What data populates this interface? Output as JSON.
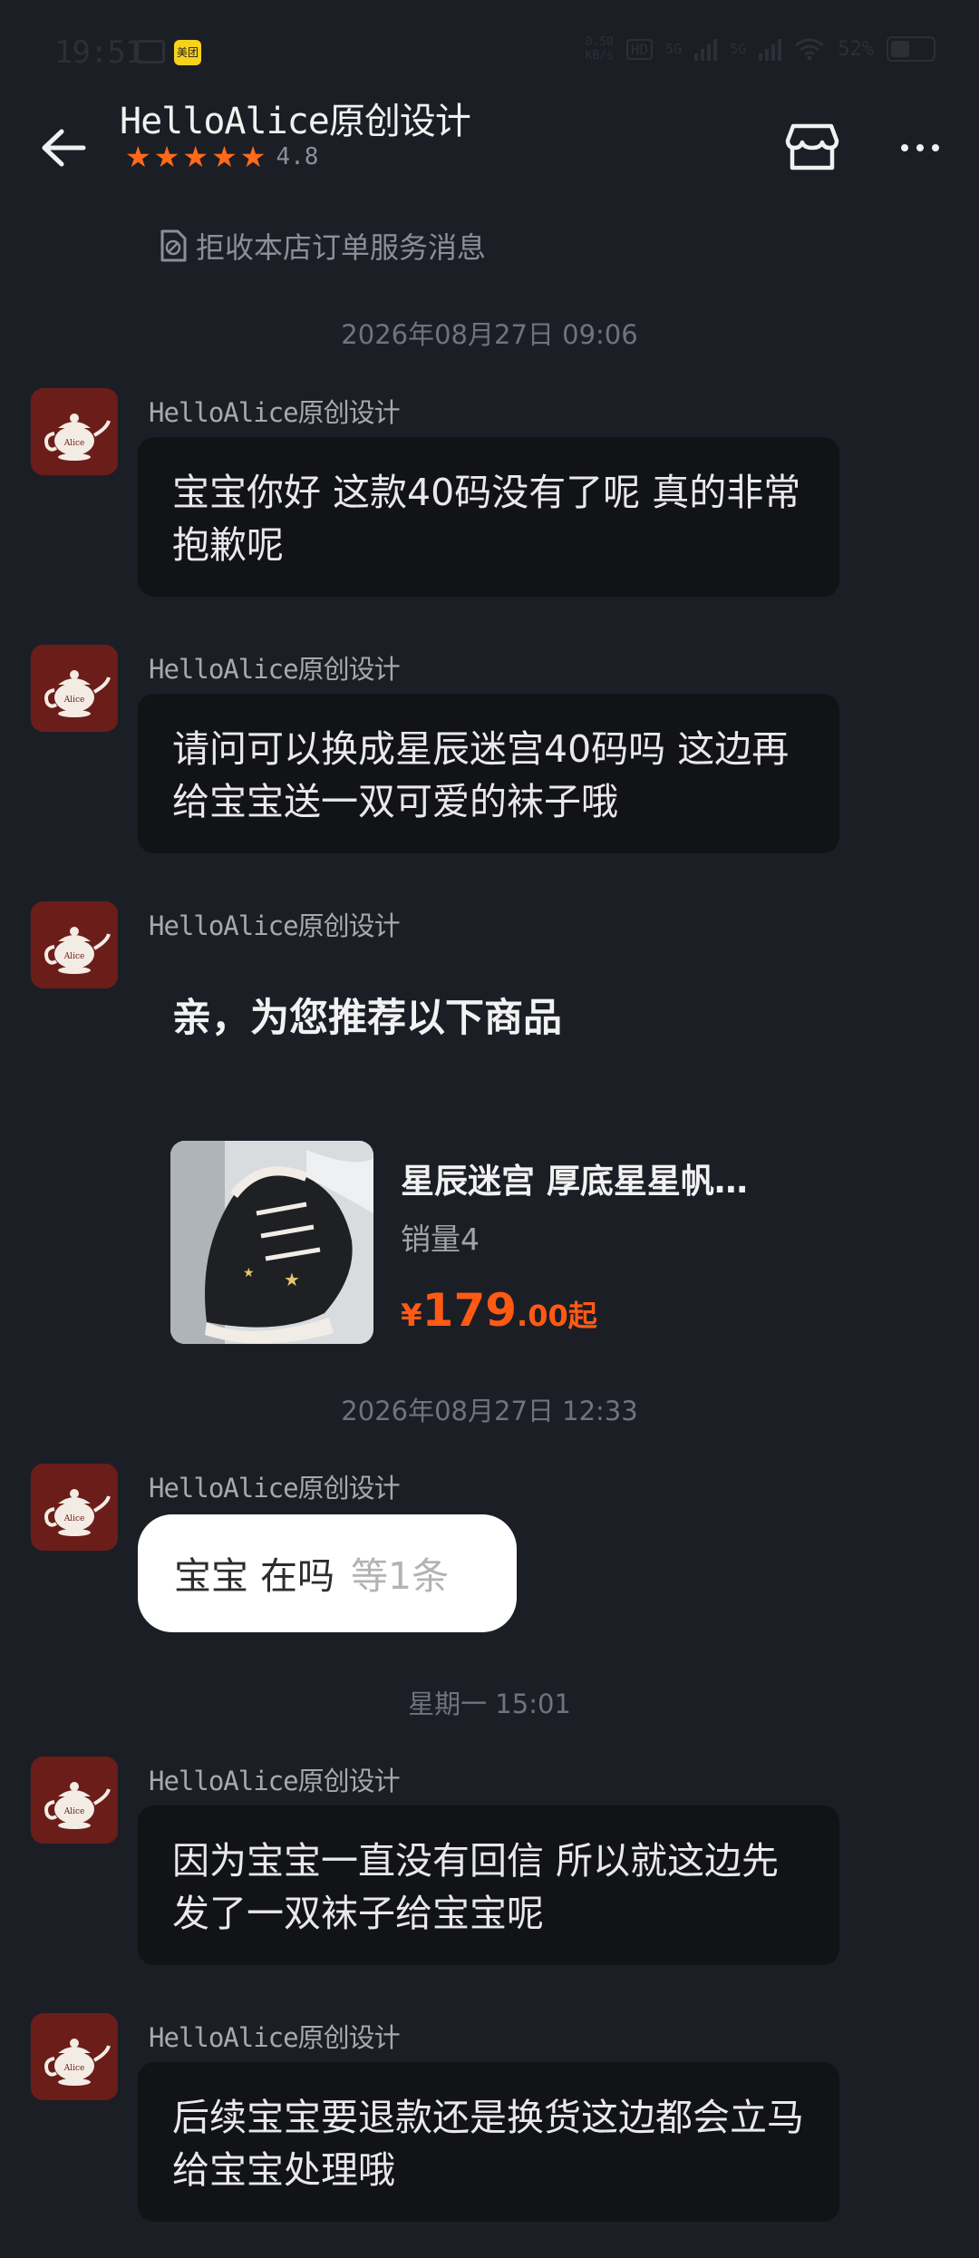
{
  "status_bar": {
    "time": "19:51",
    "app_badge": "美团",
    "speed": "0.50\nKB/s",
    "hd": "HD",
    "net1": "5G",
    "net2": "5G",
    "battery": "52%"
  },
  "header": {
    "shop_name": "HelloAlice原创设计",
    "rating": "4.8"
  },
  "notice": {
    "reject_text": "拒收本店订单服务消息"
  },
  "conversation": [
    {
      "time": "2026年08月27日 09:06"
    },
    {
      "sender": "HelloAlice原创设计",
      "text": "宝宝你好 这款40码没有了呢 真的非常抱歉呢"
    },
    {
      "sender": "HelloAlice原创设计",
      "text": "请问可以换成星辰迷宫40码吗 这边再给宝宝送一双可爱的袜子哦"
    },
    {
      "sender": "HelloAlice原创设计",
      "card_title": "亲，为您推荐以下商品",
      "product": {
        "name": "星辰迷宫 厚底星星帆…",
        "sales": "销量4",
        "price_symbol": "¥",
        "price_int": "179",
        "price_dec": ".00起"
      }
    },
    {
      "time": "2026年08月27日 12:33"
    },
    {
      "sender": "HelloAlice原创设计",
      "text": "宝宝 在吗",
      "extra": "等1条"
    },
    {
      "time": "星期一 15:01"
    },
    {
      "sender": "HelloAlice原创设计",
      "text": "因为宝宝一直没有回信 所以就这边先发了一双袜子给宝宝呢"
    },
    {
      "sender": "HelloAlice原创设计",
      "text": "后续宝宝要退款还是换货这边都会立马给宝宝处理哦"
    }
  ],
  "colors": {
    "background": "#1c1e26",
    "bubble": "#121317",
    "accent_orange": "#ff6a1a",
    "price": "#ff5a14"
  },
  "icons": [
    "back-arrow-icon",
    "star-icon",
    "store-icon",
    "more-icon",
    "block-notice-icon",
    "teapot-avatar"
  ]
}
